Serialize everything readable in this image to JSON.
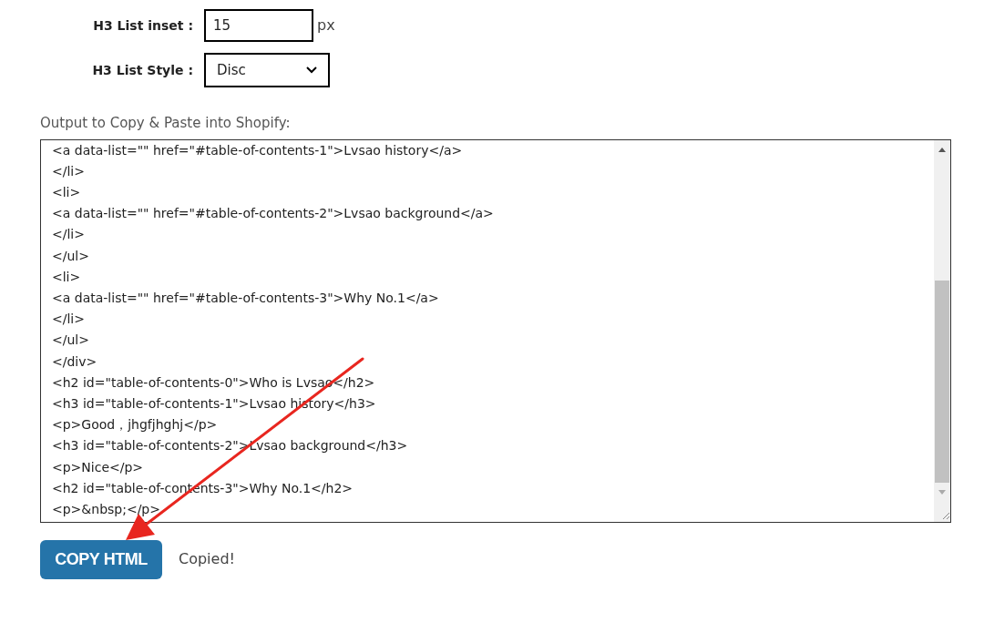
{
  "settings": [
    {
      "kind": "input",
      "label": "H3 List inset :",
      "value": "15",
      "unit": "px"
    },
    {
      "kind": "select",
      "label": "H3 List Style :",
      "value": "Disc"
    }
  ],
  "output": {
    "label": "Output to Copy & Paste into Shopify:",
    "lines": [
      "<a data-list=\"\" href=\"#table-of-contents-1\">Lvsao history</a>",
      "</li>",
      "<li>",
      "<a data-list=\"\" href=\"#table-of-contents-2\">Lvsao background</a>",
      "</li>",
      "</ul>",
      "<li>",
      "<a data-list=\"\" href=\"#table-of-contents-3\">Why No.1</a>",
      "</li>",
      "</ul>",
      "</div>",
      "<h2 id=\"table-of-contents-0\">Who is Lvsao</h2>",
      "<h3 id=\"table-of-contents-1\">Lvsao history</h3>",
      "<p>Good，jhgfjhghj</p>",
      "<h3 id=\"table-of-contents-2\">Lvsao background</h3>",
      "<p>Nice</p>",
      "<h2 id=\"table-of-contents-3\">Why No.1</h2>",
      "<p>&nbsp;</p>"
    ]
  },
  "copy_button": {
    "label": "COPY HTML"
  },
  "status": "Copied!"
}
